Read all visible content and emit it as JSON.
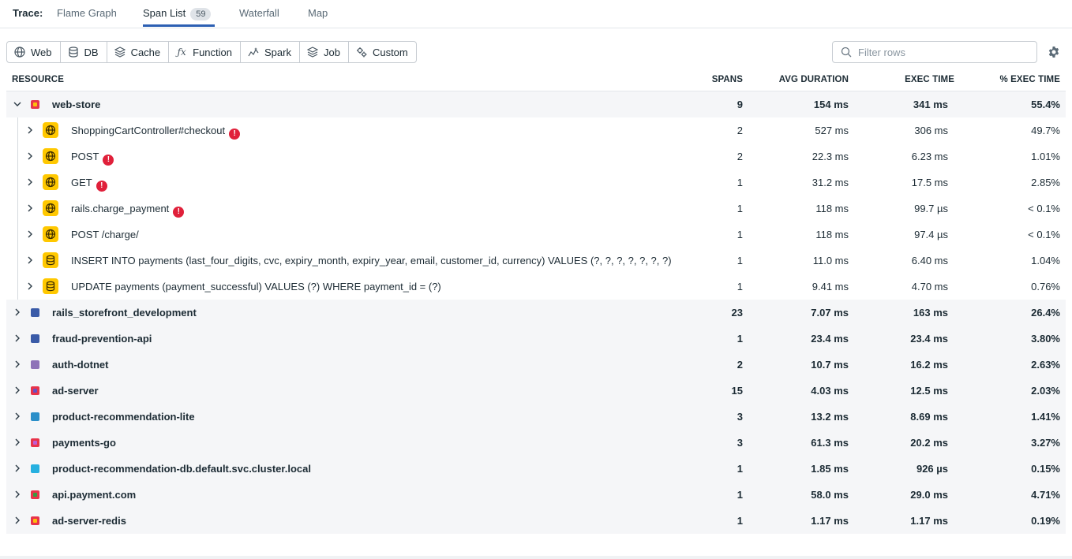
{
  "tabs": {
    "trace_label": "Trace:",
    "items": [
      {
        "label": "Flame Graph"
      },
      {
        "label": "Span List",
        "badge": "59",
        "active": true
      },
      {
        "label": "Waterfall"
      },
      {
        "label": "Map"
      }
    ]
  },
  "filters": [
    {
      "label": "Web",
      "icon": "globe-icon"
    },
    {
      "label": "DB",
      "icon": "database-icon"
    },
    {
      "label": "Cache",
      "icon": "layers-icon"
    },
    {
      "label": "Function",
      "icon": "function-icon"
    },
    {
      "label": "Spark",
      "icon": "spark-icon"
    },
    {
      "label": "Job",
      "icon": "job-stack-icon"
    },
    {
      "label": "Custom",
      "icon": "gears-icon"
    }
  ],
  "search": {
    "placeholder": "Filter rows",
    "value": ""
  },
  "columns": {
    "resource": "RESOURCE",
    "spans": "SPANS",
    "avg": "AVG DURATION",
    "exec": "EXEC TIME",
    "pct": "% EXEC TIME"
  },
  "rows": [
    {
      "kind": "group",
      "expanded": true,
      "name": "web-store",
      "color": "#e8334a",
      "spans": "9",
      "avg": "154 ms",
      "exec": "341 ms",
      "pct": "55.4%"
    },
    {
      "kind": "child",
      "type": "web",
      "name": "ShoppingCartController#checkout",
      "error": true,
      "spans": "2",
      "avg": "527 ms",
      "exec": "306 ms",
      "pct": "49.7%"
    },
    {
      "kind": "child",
      "type": "web",
      "name": "POST",
      "error": true,
      "spans": "2",
      "avg": "22.3 ms",
      "exec": "6.23 ms",
      "pct": "1.01%"
    },
    {
      "kind": "child",
      "type": "web",
      "name": "GET",
      "error": true,
      "spans": "1",
      "avg": "31.2 ms",
      "exec": "17.5 ms",
      "pct": "2.85%"
    },
    {
      "kind": "child",
      "type": "web",
      "name": "rails.charge_payment",
      "error": true,
      "spans": "1",
      "avg": "118 ms",
      "exec": "99.7 µs",
      "pct": "< 0.1%"
    },
    {
      "kind": "child",
      "type": "web",
      "name": "POST /charge/",
      "error": false,
      "spans": "1",
      "avg": "118 ms",
      "exec": "97.4 µs",
      "pct": "< 0.1%"
    },
    {
      "kind": "child",
      "type": "db",
      "name": "INSERT INTO payments (last_four_digits, cvc, expiry_month, expiry_year, email, customer_id, currency) VALUES (?, ?, ?, ?, ?, ?, ?)",
      "error": false,
      "spans": "1",
      "avg": "11.0 ms",
      "exec": "6.40 ms",
      "pct": "1.04%"
    },
    {
      "kind": "child",
      "type": "db",
      "name": "UPDATE payments (payment_successful) VALUES (?) WHERE payment_id = (?)",
      "error": false,
      "spans": "1",
      "avg": "9.41 ms",
      "exec": "4.70 ms",
      "pct": "0.76%"
    },
    {
      "kind": "group",
      "expanded": false,
      "name": "rails_storefront_development",
      "color": "#3a5ba8",
      "plain": true,
      "spans": "23",
      "avg": "7.07 ms",
      "exec": "163 ms",
      "pct": "26.4%"
    },
    {
      "kind": "group",
      "expanded": false,
      "name": "fraud-prevention-api",
      "color": "#3a5ba8",
      "plain": true,
      "spans": "1",
      "avg": "23.4 ms",
      "exec": "23.4 ms",
      "pct": "3.80%"
    },
    {
      "kind": "group",
      "expanded": false,
      "name": "auth-dotnet",
      "color": "#8e73b8",
      "plain": true,
      "spans": "2",
      "avg": "10.7 ms",
      "exec": "16.2 ms",
      "pct": "2.63%"
    },
    {
      "kind": "group",
      "expanded": false,
      "name": "ad-server",
      "color": "#e8334a",
      "inner": "#6a4fc0",
      "spans": "15",
      "avg": "4.03 ms",
      "exec": "12.5 ms",
      "pct": "2.03%"
    },
    {
      "kind": "group",
      "expanded": false,
      "name": "product-recommendation-lite",
      "color": "#2b8fc9",
      "plain": true,
      "spans": "3",
      "avg": "13.2 ms",
      "exec": "8.69 ms",
      "pct": "1.41%"
    },
    {
      "kind": "group",
      "expanded": false,
      "name": "payments-go",
      "color": "#e8334a",
      "inner": "#c05bd0",
      "spans": "3",
      "avg": "61.3 ms",
      "exec": "20.2 ms",
      "pct": "3.27%"
    },
    {
      "kind": "group",
      "expanded": false,
      "name": "product-recommendation-db.default.svc.cluster.local",
      "color": "#26b0e0",
      "plain": true,
      "spans": "1",
      "avg": "1.85 ms",
      "exec": "926 µs",
      "pct": "0.15%"
    },
    {
      "kind": "group",
      "expanded": false,
      "name": "api.payment.com",
      "color": "#e8334a",
      "inner": "#3a9a40",
      "spans": "1",
      "avg": "58.0 ms",
      "exec": "29.0 ms",
      "pct": "4.71%"
    },
    {
      "kind": "group",
      "expanded": false,
      "name": "ad-server-redis",
      "color": "#e8334a",
      "spans": "1",
      "avg": "1.17 ms",
      "exec": "1.17 ms",
      "pct": "0.19%"
    }
  ]
}
